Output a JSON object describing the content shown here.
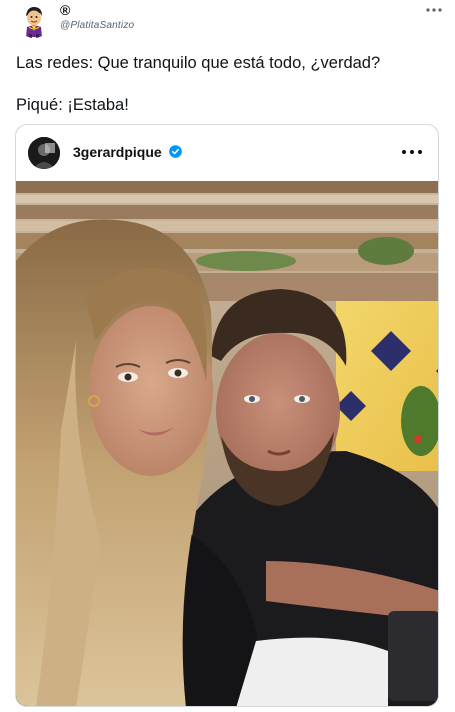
{
  "author": {
    "name": "®",
    "handle": "@PlatitaSantizo",
    "more_icon": "more-horizontal-icon"
  },
  "tweet": {
    "line1": "Las redes: Que tranquilo que está todo, ¿verdad?",
    "line2": "Piqué: ¡Estaba!"
  },
  "embedded_post": {
    "username": "3gerardpique",
    "verified": true,
    "more_icon": "more-horizontal-icon",
    "photo": "selfie-couple-photo"
  },
  "colors": {
    "text": "#0f1419",
    "secondary": "#536471",
    "border": "#cfd9de",
    "verified": "#0095f6"
  }
}
